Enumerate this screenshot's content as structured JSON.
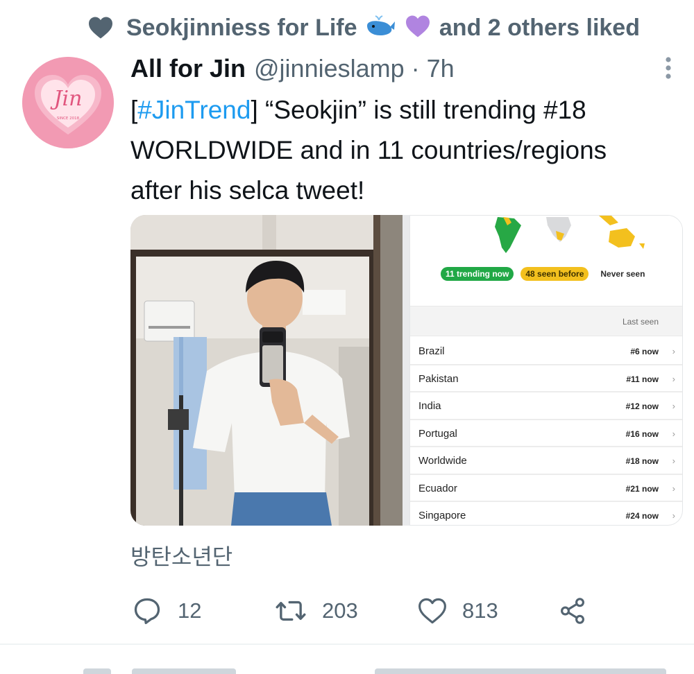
{
  "social_context": {
    "prefix": "Seokjinniess for Life",
    "suffix": "and 2 others liked",
    "icon": "heart-filled-icon",
    "emojis": [
      "whale-emoji",
      "purple-heart-emoji"
    ]
  },
  "tweet": {
    "avatar": {
      "text": "Jin",
      "subtext": "SINCE 2018"
    },
    "display_name": "All for Jin",
    "handle": "@jinnieslamp",
    "separator": "·",
    "time": "7h",
    "text": {
      "line1_bracket_open": "[",
      "hashtag": "#JinTrend",
      "line1_rest": "] “Seokjin” is still trending #18",
      "line2": "WORLDWIDE and in 11 countries/regions",
      "line3": "after his selca tweet!"
    },
    "trend_panel": {
      "legend": [
        "11 trending now",
        "48 seen before",
        "Never seen"
      ],
      "column_header": "Last seen",
      "rows": [
        {
          "country": "Brazil",
          "rank": "#6 now"
        },
        {
          "country": "Pakistan",
          "rank": "#11 now"
        },
        {
          "country": "India",
          "rank": "#12 now"
        },
        {
          "country": "Portugal",
          "rank": "#16 now"
        },
        {
          "country": "Worldwide",
          "rank": "#18 now"
        },
        {
          "country": "Ecuador",
          "rank": "#21 now"
        },
        {
          "country": "Singapore",
          "rank": "#24 now"
        }
      ]
    },
    "translation_hint": "방탄소년단",
    "actions": {
      "replies": "12",
      "retweets": "203",
      "likes": "813"
    }
  },
  "colors": {
    "text_primary": "#0f1419",
    "text_secondary": "#536471",
    "accent_blue": "#1d9bf0",
    "trend_green": "#21a846",
    "trend_yellow": "#f3c01e",
    "avatar_pink": "#f29ab3"
  }
}
